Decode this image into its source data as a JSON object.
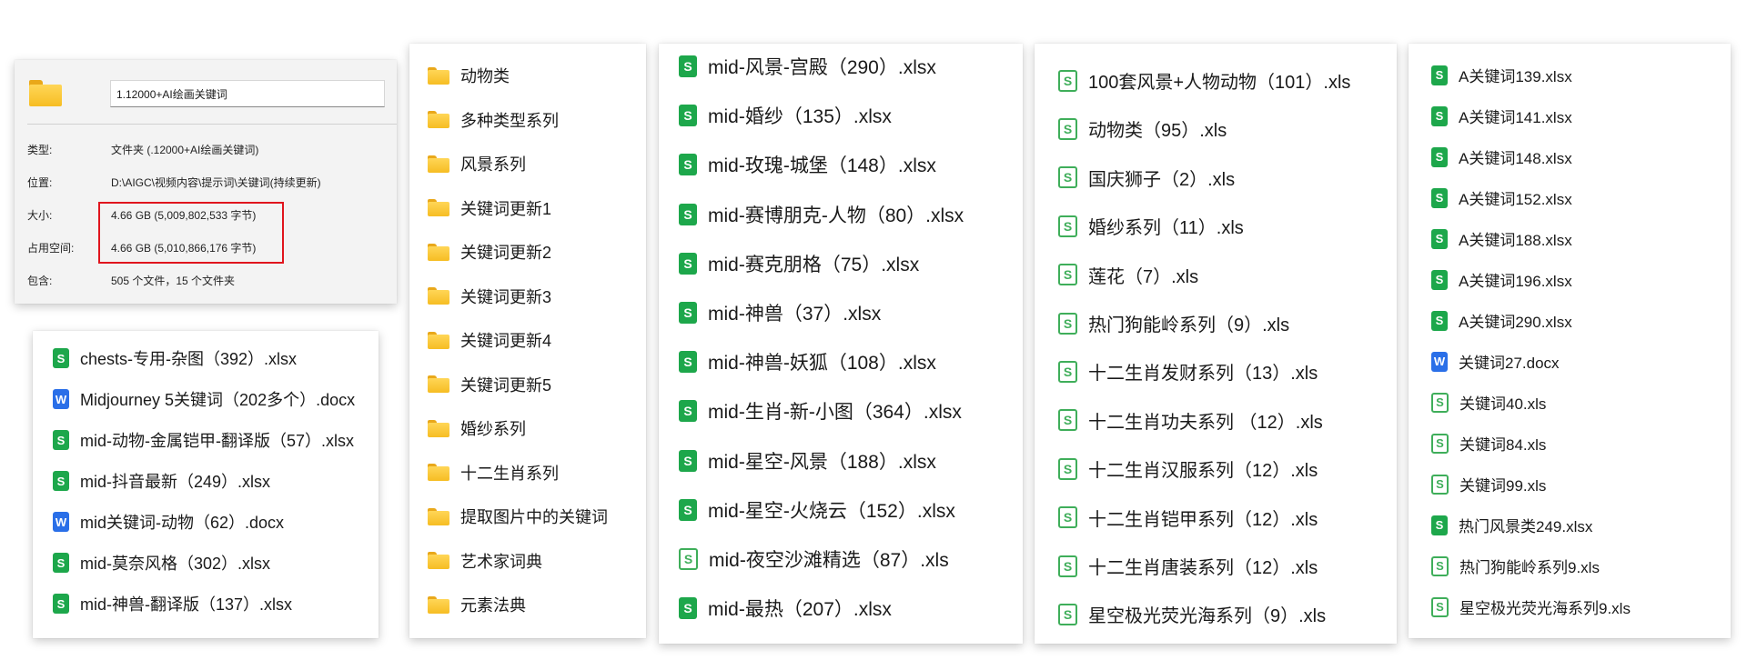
{
  "properties": {
    "folder_name": "1.12000+AI绘画关键词",
    "rows": [
      {
        "key": "类型:",
        "value": "文件夹 (.12000+AI绘画关键词)"
      },
      {
        "key": "位置:",
        "value": "D:\\AIGC\\视频内容\\提示词\\关键词(持续更新)"
      },
      {
        "key": "大小:",
        "value": "4.66 GB (5,009,802,533 字节)"
      },
      {
        "key": "占用空间:",
        "value": "4.66 GB (5,010,866,176 字节)"
      },
      {
        "key": "包含:",
        "value": "505 个文件，15 个文件夹"
      }
    ]
  },
  "files_a": [
    {
      "name": "chests-专用-杂图（392）.xlsx",
      "icon": "xlsx-icon"
    },
    {
      "name": "Midjourney 5关键词（202多个）.docx",
      "icon": "docx-icon"
    },
    {
      "name": "mid-动物-金属铠甲-翻译版（57）.xlsx",
      "icon": "xlsx-icon"
    },
    {
      "name": "mid-抖音最新（249）.xlsx",
      "icon": "xlsx-icon"
    },
    {
      "name": "mid关键词-动物（62）.docx",
      "icon": "docx-icon"
    },
    {
      "name": "mid-莫奈风格（302）.xlsx",
      "icon": "xlsx-icon"
    },
    {
      "name": "mid-神兽-翻译版（137）.xlsx",
      "icon": "xlsx-icon"
    }
  ],
  "folders": [
    "动物类",
    "多种类型系列",
    "风景系列",
    "关键词更新1",
    "关键词更新2",
    "关键词更新3",
    "关键词更新4",
    "关键词更新5",
    "婚纱系列",
    "十二生肖系列",
    "提取图片中的关键词",
    "艺术家词典",
    "元素法典"
  ],
  "files_mid": [
    {
      "name": "mid-风景-宫殿（290）.xlsx",
      "icon": "xlsx-icon"
    },
    {
      "name": "mid-婚纱（135）.xlsx",
      "icon": "xlsx-icon"
    },
    {
      "name": "mid-玫瑰-城堡（148）.xlsx",
      "icon": "xlsx-icon"
    },
    {
      "name": "mid-赛博朋克-人物（80）.xlsx",
      "icon": "xlsx-icon"
    },
    {
      "name": "mid-赛克朋格（75）.xlsx",
      "icon": "xlsx-icon"
    },
    {
      "name": "mid-神兽（37）.xlsx",
      "icon": "xlsx-icon"
    },
    {
      "name": "mid-神兽-妖狐（108）.xlsx",
      "icon": "xlsx-icon"
    },
    {
      "name": "mid-生肖-新-小图（364）.xlsx",
      "icon": "xlsx-icon"
    },
    {
      "name": "mid-星空-风景（188）.xlsx",
      "icon": "xlsx-icon"
    },
    {
      "name": "mid-星空-火烧云（152）.xlsx",
      "icon": "xlsx-icon"
    },
    {
      "name": "mid-夜空沙滩精选（87）.xls",
      "icon": "xls-icon"
    },
    {
      "name": "mid-最热（207）.xlsx",
      "icon": "xlsx-icon"
    }
  ],
  "files_xls": [
    "100套风景+人物动物（101）.xls",
    "动物类（95）.xls",
    "国庆狮子（2）.xls",
    "婚纱系列（11）.xls",
    "莲花（7）.xls",
    "热门狗能岭系列（9）.xls",
    "十二生肖发财系列（13）.xls",
    "十二生肖功夫系列 （12）.xls",
    "十二生肖汉服系列（12）.xls",
    "十二生肖铠甲系列（12）.xls",
    "十二生肖唐装系列（12）.xls",
    "星空极光荧光海系列（9）.xls"
  ],
  "files_a_keywords": [
    {
      "name": "A关键词139.xlsx",
      "icon": "xlsx-icon"
    },
    {
      "name": "A关键词141.xlsx",
      "icon": "xlsx-icon"
    },
    {
      "name": "A关键词148.xlsx",
      "icon": "xlsx-icon"
    },
    {
      "name": "A关键词152.xlsx",
      "icon": "xlsx-icon"
    },
    {
      "name": "A关键词188.xlsx",
      "icon": "xlsx-icon"
    },
    {
      "name": "A关键词196.xlsx",
      "icon": "xlsx-icon"
    },
    {
      "name": "A关键词290.xlsx",
      "icon": "xlsx-icon"
    },
    {
      "name": "关键词27.docx",
      "icon": "docx-icon"
    },
    {
      "name": "关键词40.xls",
      "icon": "xls-icon"
    },
    {
      "name": "关键词84.xls",
      "icon": "xls-icon"
    },
    {
      "name": "关键词99.xls",
      "icon": "xls-icon"
    },
    {
      "name": "热门风景类249.xlsx",
      "icon": "xlsx-icon"
    },
    {
      "name": "热门狗能岭系列9.xls",
      "icon": "xls-icon"
    },
    {
      "name": "星空极光荧光海系列9.xls",
      "icon": "xls-icon"
    }
  ],
  "colors": {
    "highlight": "#e0151d",
    "xlsx": "#1da74b",
    "docx": "#2a6fe8",
    "folder": "#f6bd23"
  }
}
